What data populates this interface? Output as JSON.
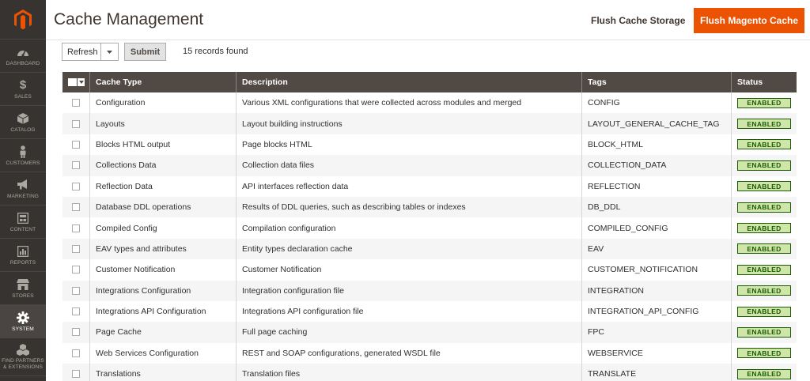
{
  "sidebar": {
    "items": [
      {
        "label": "DASHBOARD",
        "icon": "dashboard-icon"
      },
      {
        "label": "SALES",
        "icon": "dollar-icon"
      },
      {
        "label": "CATALOG",
        "icon": "box-icon"
      },
      {
        "label": "CUSTOMERS",
        "icon": "person-icon"
      },
      {
        "label": "MARKETING",
        "icon": "megaphone-icon"
      },
      {
        "label": "CONTENT",
        "icon": "content-icon"
      },
      {
        "label": "REPORTS",
        "icon": "bar-chart-icon"
      },
      {
        "label": "STORES",
        "icon": "store-icon"
      },
      {
        "label": "SYSTEM",
        "icon": "gear-icon"
      },
      {
        "label_line1": "FIND PARTNERS",
        "label_line2": "& EXTENSIONS",
        "icon": "cubes-icon"
      }
    ]
  },
  "header": {
    "title": "Cache Management",
    "flush_storage": "Flush Cache Storage",
    "flush_magento": "Flush Magento Cache"
  },
  "toolbar": {
    "action_value": "Refresh",
    "submit_label": "Submit",
    "records_found": "15 records found"
  },
  "table": {
    "columns": [
      "Cache Type",
      "Description",
      "Tags",
      "Status"
    ],
    "rows": [
      {
        "type": "Configuration",
        "desc": "Various XML configurations that were collected across modules and merged",
        "tags": "CONFIG",
        "status": "ENABLED"
      },
      {
        "type": "Layouts",
        "desc": "Layout building instructions",
        "tags": "LAYOUT_GENERAL_CACHE_TAG",
        "status": "ENABLED"
      },
      {
        "type": "Blocks HTML output",
        "desc": "Page blocks HTML",
        "tags": "BLOCK_HTML",
        "status": "ENABLED"
      },
      {
        "type": "Collections Data",
        "desc": "Collection data files",
        "tags": "COLLECTION_DATA",
        "status": "ENABLED"
      },
      {
        "type": "Reflection Data",
        "desc": "API interfaces reflection data",
        "tags": "REFLECTION",
        "status": "ENABLED"
      },
      {
        "type": "Database DDL operations",
        "desc": "Results of DDL queries, such as describing tables or indexes",
        "tags": "DB_DDL",
        "status": "ENABLED"
      },
      {
        "type": "Compiled Config",
        "desc": "Compilation configuration",
        "tags": "COMPILED_CONFIG",
        "status": "ENABLED"
      },
      {
        "type": "EAV types and attributes",
        "desc": "Entity types declaration cache",
        "tags": "EAV",
        "status": "ENABLED"
      },
      {
        "type": "Customer Notification",
        "desc": "Customer Notification",
        "tags": "CUSTOMER_NOTIFICATION",
        "status": "ENABLED"
      },
      {
        "type": "Integrations Configuration",
        "desc": "Integration configuration file",
        "tags": "INTEGRATION",
        "status": "ENABLED"
      },
      {
        "type": "Integrations API Configuration",
        "desc": "Integrations API configuration file",
        "tags": "INTEGRATION_API_CONFIG",
        "status": "ENABLED"
      },
      {
        "type": "Page Cache",
        "desc": "Full page caching",
        "tags": "FPC",
        "status": "ENABLED"
      },
      {
        "type": "Web Services Configuration",
        "desc": "REST and SOAP configurations, generated WSDL file",
        "tags": "WEBSERVICE",
        "status": "ENABLED"
      },
      {
        "type": "Translations",
        "desc": "Translation files",
        "tags": "TRANSLATE",
        "status": "ENABLED"
      }
    ]
  },
  "colors": {
    "accent": "#eb5202",
    "sidebar_bg": "#373330",
    "table_header_bg": "#514943",
    "enabled_bg": "#d0e5a9",
    "enabled_text": "#185b00"
  }
}
